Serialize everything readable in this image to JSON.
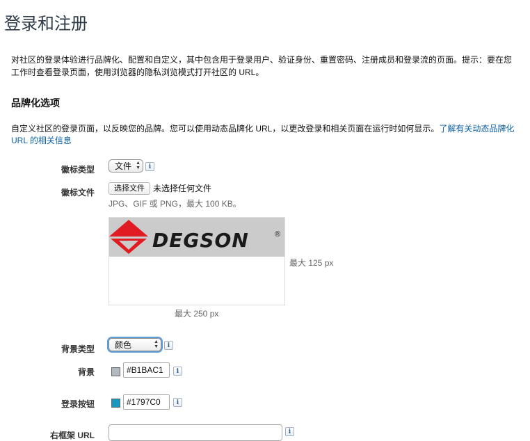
{
  "page": {
    "title": "登录和注册",
    "intro": "对社区的登录体验进行品牌化、配置和自定义，其中包含用于登录用户、验证身份、重置密码、注册成员和登录流的页面。提示：要在您工作时查看登录页面，使用浏览器的隐私浏览模式打开社区的 URL。"
  },
  "branding": {
    "section_title": "品牌化选项",
    "description": "自定义社区的登录页面，以反映您的品牌。您可以使用动态品牌化 URL，以更改登录和相关页面在运行时如何显示。",
    "learn_more_link": "了解有关动态品牌化 URL 的相关信息",
    "logo_type": {
      "label": "徽标类型",
      "value": "文件"
    },
    "logo_file": {
      "label": "徽标文件",
      "button": "选择文件",
      "status": "未选择任何文件",
      "hint": "JPG、GIF 或 PNG，最大 100 KB。"
    },
    "preview": {
      "logo_text": "DEGSON",
      "registered_mark": "®",
      "max_height": "最大 125 px",
      "max_width": "最大 250 px"
    },
    "background_type": {
      "label": "背景类型",
      "value": "颜色"
    },
    "background": {
      "label": "背景",
      "value": "#B1BAC1",
      "swatch_color": "#B1BAC1"
    },
    "login_button": {
      "label": "登录按钮",
      "value": "#1797C0",
      "swatch_color": "#1797C0"
    },
    "right_frame_url": {
      "label": "右框架 URL",
      "value": ""
    },
    "info_icon_text": "i",
    "colors": {
      "link": "#0b5fa5",
      "focus_ring": "#5b9dd9",
      "logo_red": "#e11b22"
    }
  }
}
